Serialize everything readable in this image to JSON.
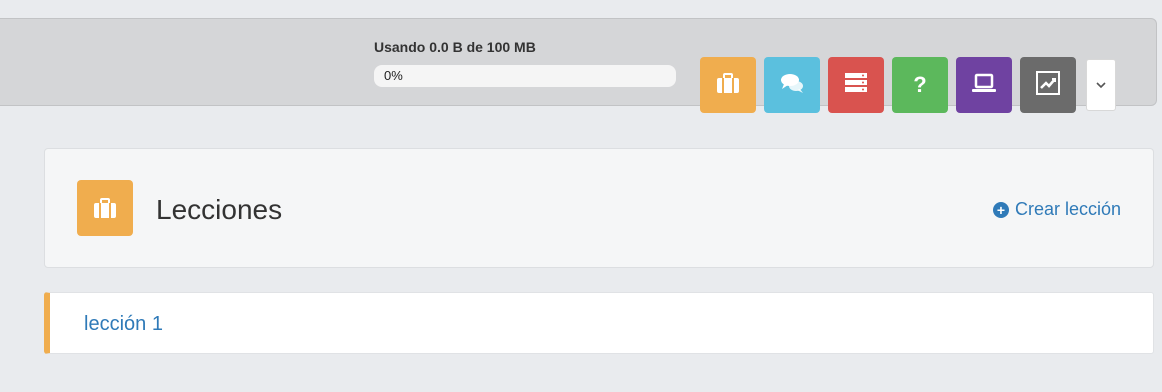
{
  "storage": {
    "usage_label": "Usando 0.0 B de 100 MB",
    "progress_text": "0%",
    "progress_fraction": 0
  },
  "toolbar": {
    "buttons": [
      {
        "name": "lessons",
        "icon": "briefcase-icon",
        "color": "#f0ad4e"
      },
      {
        "name": "messages",
        "icon": "chat-bubbles-icon",
        "color": "#5bc0de"
      },
      {
        "name": "list",
        "icon": "stacked-list-icon",
        "color": "#d9534f"
      },
      {
        "name": "help",
        "icon": "question-icon",
        "color": "#5cb85c",
        "label": "?"
      },
      {
        "name": "computer",
        "icon": "laptop-icon",
        "color": "#6f42a1"
      },
      {
        "name": "stats",
        "icon": "line-chart-icon",
        "color": "#6b6b6b"
      }
    ],
    "dropdown_icon": "chevron-down-icon"
  },
  "lessons_panel": {
    "title": "Lecciones",
    "icon": "briefcase-icon",
    "accent": "#f0ad4e",
    "create_label": "Crear lección"
  },
  "lessons": [
    {
      "title": "lección 1"
    }
  ],
  "colors": {
    "link": "#2f7ab8",
    "background": "#e9ebee"
  }
}
